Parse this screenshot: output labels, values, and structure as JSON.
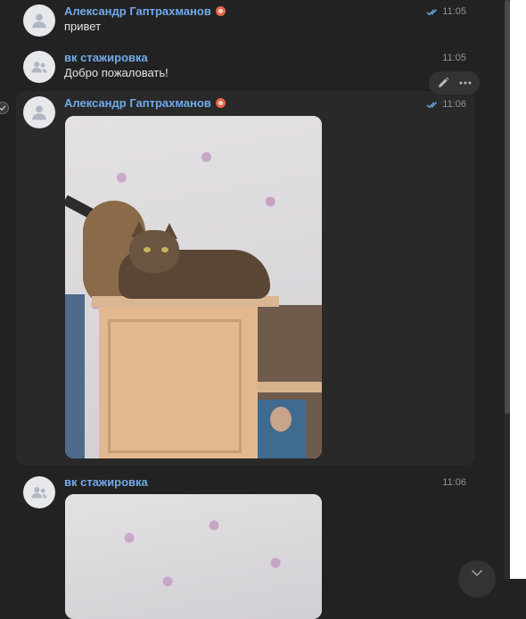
{
  "messages": [
    {
      "author": "Александр Гаптрахманов",
      "text": "привет",
      "time": "11:05",
      "read": true,
      "avatar_icon": "user-icon"
    },
    {
      "author": "вк стажировка",
      "text": "Добро пожаловать!",
      "time": "11:05",
      "avatar_icon": "group-icon"
    },
    {
      "author": "Александр Гаптрахманов",
      "time": "11:06",
      "read": true,
      "attachment": "photo-cat-on-cabinet",
      "avatar_icon": "user-icon"
    },
    {
      "author": "вк стажировка",
      "time": "11:06",
      "attachment": "photo-cat-on-cabinet",
      "avatar_icon": "group-icon"
    }
  ],
  "actions": {
    "edit_icon": "pencil-icon",
    "more_icon": "more-dots-icon"
  },
  "colors": {
    "background": "#222222",
    "author_link": "#71aaeb",
    "text": "#e1e3e6",
    "time": "#939393",
    "read_check": "#71aaeb"
  }
}
